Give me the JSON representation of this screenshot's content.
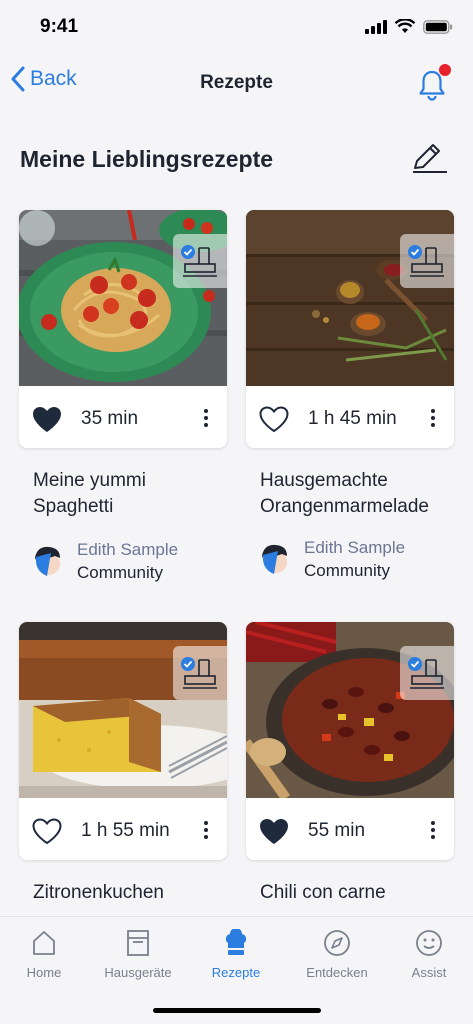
{
  "status": {
    "time": "9:41"
  },
  "nav": {
    "back_label": "Back",
    "title": "Rezepte"
  },
  "section": {
    "title": "Meine Lieblingsrezepte"
  },
  "recipes": [
    {
      "title": "Meine yummi\nSpaghetti",
      "time": "35 min",
      "favorited": true,
      "author_name": "Edith Sample",
      "author_org": "Community"
    },
    {
      "title": "Hausgemachte\nOrangenmarmelade",
      "time": "1 h 45 min",
      "favorited": false,
      "author_name": "Edith Sample",
      "author_org": "Community"
    },
    {
      "title": "Zitronenkuchen",
      "time": "1 h 55 min",
      "favorited": false
    },
    {
      "title": "Chili con carne",
      "time": "55 min",
      "favorited": true
    }
  ],
  "tabs": [
    {
      "label": "Home",
      "icon": "home-icon"
    },
    {
      "label": "Hausgeräte",
      "icon": "appliance-icon"
    },
    {
      "label": "Rezepte",
      "icon": "chef-hat-icon",
      "active": true
    },
    {
      "label": "Entdecken",
      "icon": "compass-icon"
    },
    {
      "label": "Assist",
      "icon": "assist-smiley-icon"
    }
  ],
  "colors": {
    "accent": "#2b7de0",
    "notification": "#e8202c",
    "text": "#1f2430",
    "muted": "#6a7694"
  }
}
